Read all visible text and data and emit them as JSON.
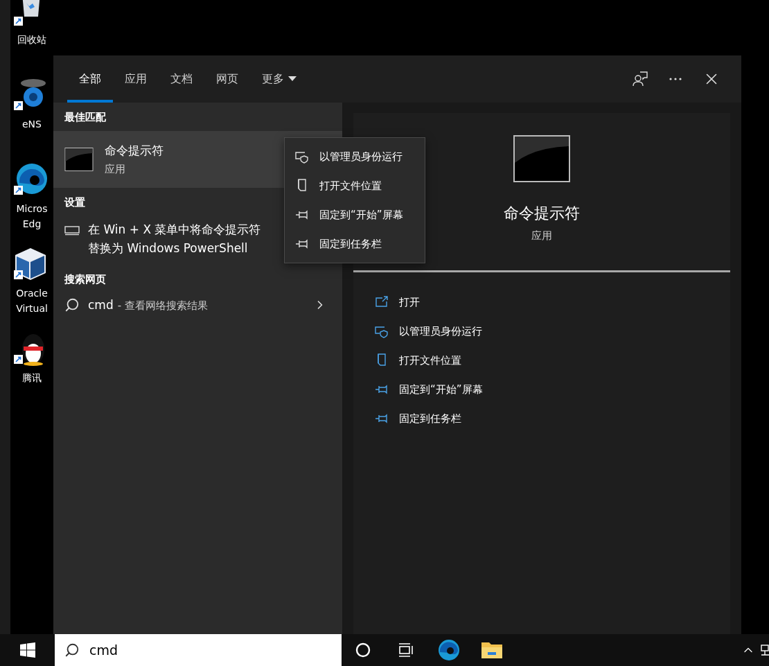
{
  "desktop_icons": [
    {
      "kind": "recycle-bin",
      "lines": [
        "回收站"
      ]
    },
    {
      "kind": "network-tool",
      "lines": [
        "eNS"
      ]
    },
    {
      "kind": "browser",
      "lines": [
        "Micros",
        "Edg"
      ]
    },
    {
      "kind": "cube",
      "lines": [
        "Oracle",
        "Virtual"
      ]
    },
    {
      "kind": "penguin",
      "lines": [
        "腾讯"
      ]
    }
  ],
  "search_flyout": {
    "tabs": [
      {
        "label": "全部",
        "selected": true
      },
      {
        "label": "应用",
        "selected": false
      },
      {
        "label": "文档",
        "selected": false
      },
      {
        "label": "网页",
        "selected": false
      },
      {
        "label": "更多",
        "selected": false,
        "kind": "dropdown"
      }
    ],
    "best_match": {
      "heading": "最佳匹配",
      "title": "命令提示符",
      "subtitle": "应用",
      "selected": true
    },
    "settings": {
      "heading": "设置",
      "lines": [
        "在 Win + X 菜单中将命令提示符",
        "替换为 Windows PowerShell"
      ]
    },
    "web": {
      "heading": "搜索网页",
      "query": "cmd",
      "suffix": "- 查看网络搜索结果"
    },
    "context_menu": [
      {
        "kind": "admin",
        "label": "以管理员身份运行"
      },
      {
        "kind": "location",
        "label": "打开文件位置"
      },
      {
        "kind": "pin",
        "label": "固定到“开始”屏幕"
      },
      {
        "kind": "pin",
        "label": "固定到任务栏"
      }
    ],
    "detail": {
      "title": "命令提示符",
      "subtitle": "应用",
      "actions": [
        {
          "kind": "open",
          "label": "打开"
        },
        {
          "kind": "admin",
          "label": "以管理员身份运行"
        },
        {
          "kind": "location",
          "label": "打开文件位置"
        },
        {
          "kind": "pin",
          "label": "固定到“开始”屏幕"
        },
        {
          "kind": "pin",
          "label": "固定到任务栏"
        }
      ]
    }
  },
  "taskbar": {
    "search": {
      "value": "cmd"
    }
  }
}
